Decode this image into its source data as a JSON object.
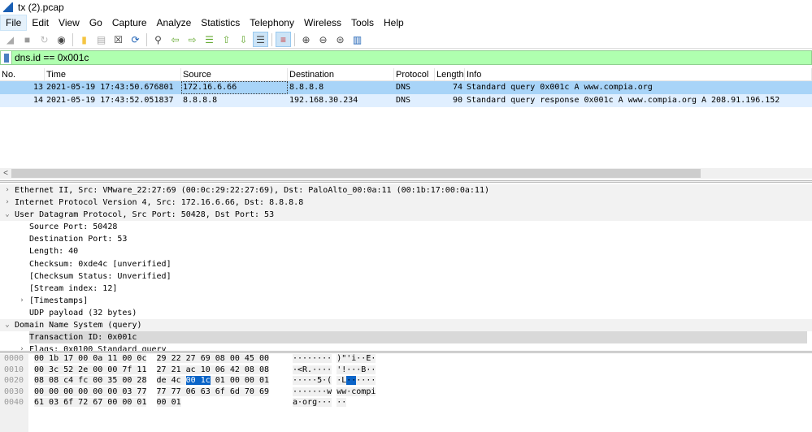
{
  "window": {
    "title": "tx (2).pcap"
  },
  "menu": [
    "File",
    "Edit",
    "View",
    "Go",
    "Capture",
    "Analyze",
    "Statistics",
    "Telephony",
    "Wireless",
    "Tools",
    "Help"
  ],
  "toolbar": [
    "start-capture",
    "stop-capture",
    "restart-capture",
    "capture-options",
    "open-file",
    "save-file",
    "close-file",
    "reload-file",
    "find-packet",
    "go-back",
    "go-forward",
    "go-to-packet",
    "go-first",
    "go-last",
    "auto-scroll",
    "colorize",
    "zoom-in",
    "zoom-out",
    "normal-size",
    "resize-columns"
  ],
  "filter": {
    "value": "dns.id == 0x001c"
  },
  "packet_list": {
    "columns": [
      "No.",
      "Time",
      "Source",
      "Destination",
      "Protocol",
      "Length",
      "Info"
    ],
    "rows": [
      {
        "no": "13",
        "time": "2021-05-19 17:43:50.676801",
        "src": "172.16.6.66",
        "dst": "8.8.8.8",
        "proto": "DNS",
        "len": "74",
        "info": "Standard query 0x001c A www.compia.org"
      },
      {
        "no": "14",
        "time": "2021-05-19 17:43:52.051837",
        "src": "8.8.8.8",
        "dst": "192.168.30.234",
        "proto": "DNS",
        "len": "90",
        "info": "Standard query response 0x001c A www.compia.org A 208.91.196.152"
      }
    ]
  },
  "details": [
    {
      "text": "Ethernet II, Src: VMware_22:27:69 (00:0c:29:22:27:69), Dst: PaloAlto_00:0a:11 (00:1b:17:00:0a:11)",
      "state": "collapsed"
    },
    {
      "text": "Internet Protocol Version 4, Src: 172.16.6.66, Dst: 8.8.8.8",
      "state": "collapsed"
    },
    {
      "text": "User Datagram Protocol, Src Port: 50428, Dst Port: 53",
      "state": "expanded"
    },
    {
      "text": "Source Port: 50428"
    },
    {
      "text": "Destination Port: 53"
    },
    {
      "text": "Length: 40"
    },
    {
      "text": "Checksum: 0xde4c [unverified]"
    },
    {
      "text": "[Checksum Status: Unverified]"
    },
    {
      "text": "[Stream index: 12]"
    },
    {
      "text": "[Timestamps]",
      "state": "collapsed"
    },
    {
      "text": "UDP payload (32 bytes)"
    },
    {
      "text": "Domain Name System (query)",
      "state": "expanded"
    },
    {
      "text": "Transaction ID: 0x001c",
      "selected": true
    },
    {
      "text": "Flags: 0x0100 Standard query",
      "state": "collapsed"
    }
  ],
  "hex": {
    "offsets": [
      "0000",
      "0010",
      "0020",
      "0030",
      "0040"
    ],
    "lines": [
      [
        "00 1b 17 00 0a 11 00 0c",
        "29 22 27 69 08 00 45 00",
        "········",
        ")\"'i··E·"
      ],
      [
        "00 3c 52 2e 00 00 7f 11",
        "27 21 ac 10 06 42 08 08",
        "·<R.····",
        "'!···B··"
      ],
      [
        "08 08 c4 fc 00 35 00 28",
        "de 4c 00 1c 01 00 00 01",
        "·····5·(",
        "·L······"
      ],
      [
        "00 00 00 00 00 00 03 77",
        "77 77 06 63 6f 6d 70 69",
        "·······w",
        "ww·compi"
      ],
      [
        "61 03 6f 72 67 00 00 01",
        "00 01",
        "a·org···",
        "··"
      ]
    ]
  }
}
